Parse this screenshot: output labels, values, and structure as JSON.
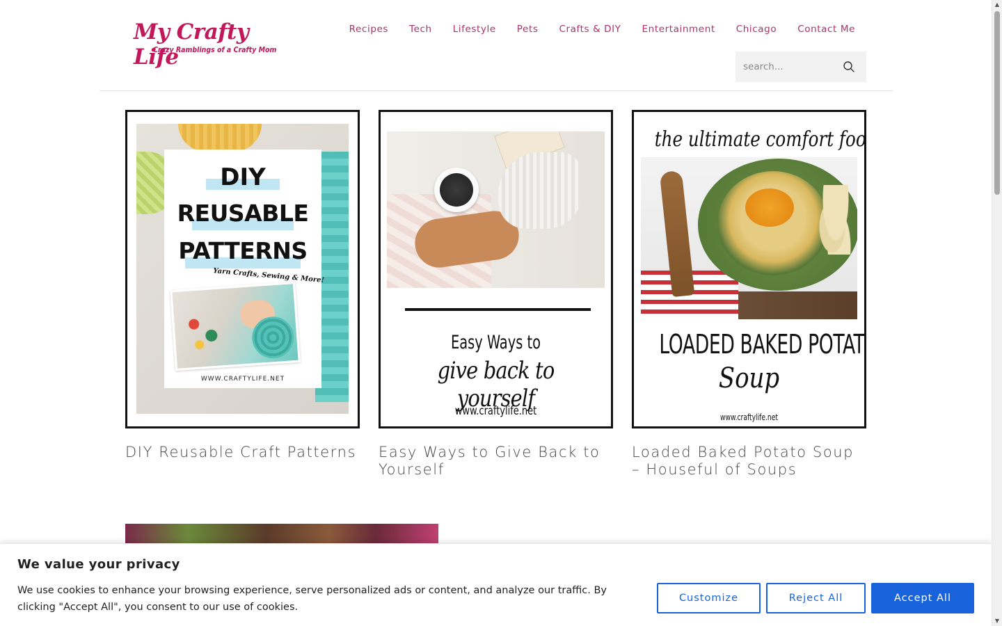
{
  "site": {
    "logo_title": "My Crafty Life",
    "logo_subtitle": "Crazy Ramblings of a Crafty Mom",
    "brand_color": "#c2185b"
  },
  "nav": {
    "items": [
      "Recipes",
      "Tech",
      "Lifestyle",
      "Pets",
      "Crafts & DIY",
      "Entertainment",
      "Chicago",
      "Contact Me"
    ]
  },
  "search": {
    "placeholder": "search...",
    "icon": "search-icon"
  },
  "posts": [
    {
      "title": "DIY Reusable Craft Patterns",
      "image_text": {
        "line1": "DIY",
        "line2": "REUSABLE",
        "line3": "PATTERNS",
        "script": "Yarn Crafts, Sewing & More!",
        "url": "WWW.CRAFTYLIFE.NET"
      }
    },
    {
      "title": "Easy Ways to Give Back to Yourself",
      "image_text": {
        "line1": "Easy Ways to",
        "line2": "give back to yourself",
        "url": "www.craftylife.net"
      }
    },
    {
      "title": "Loaded Baked Potato Soup – Houseful of Soups",
      "image_text": {
        "top": "the ultimate comfort food",
        "line1": "LOADED BAKED POTATO",
        "line2": "Soup",
        "url": "www.craftylife.net"
      }
    }
  ],
  "cookie_banner": {
    "title": "We value your privacy",
    "text": "We use cookies to enhance your browsing experience, serve personalized ads or content, and analyze our traffic. By clicking \"Accept All\", you consent to our use of cookies.",
    "customize_label": "Customize",
    "reject_label": "Reject All",
    "accept_label": "Accept All",
    "accent_color": "#1863dc"
  }
}
